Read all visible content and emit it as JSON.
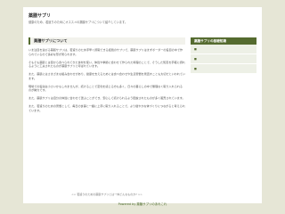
{
  "header": {
    "site_title": "薬膳サプリ",
    "site_description": "健康のため、若返りのためにオススメの薬膳サプリについて紹介しています。"
  },
  "entry": {
    "title": "薬膳サプリについて",
    "paragraphs": [
      "いま注目を浴びる薬膳サプリは、若返りのため手早く摂取できる話題のサプリで、薬膳サプリはまずボーダーの役目の中で作られているので多彩な形が見られます。",
      "そもそも薬膳とは昔から食べられてきた食材を使い、体質や季節に合わせて作られた料理のことで、そうした知恵を手軽に摂れるように工夫されたものが薬膳サプリと呼ばれています。",
      "また、薬膳にはさまざまな組み合わせがあり、健康を支えるためには食べ合わせや生活習慣を見直すことも大切だといわれています。",
      "現場での役割は小さいかもしれませんが、続けることで変化を感じる方も多く、日々の暮らしの中で無理なく取り入れられるのが魅力です。",
      "また、薬膳サプリは自分の体質に合わせて選ぶことができ、安心して続けられるよう配慮されたものが多く販売されています。",
      "また、若返りのための習慣として、毎日の食事と一緒に上手に取り入れることで、より健やかな体づくりにつながると考えられています。"
    ],
    "more_link": "<< 若返りのための薬膳サプリとは一体どんなものか? >>"
  },
  "sidebar": {
    "title": "薬膳サプリの基礎知識",
    "items": [
      "■",
      "■",
      "■"
    ]
  },
  "footer": {
    "text": "Powered by 薬膳サプリのあれこれ"
  }
}
